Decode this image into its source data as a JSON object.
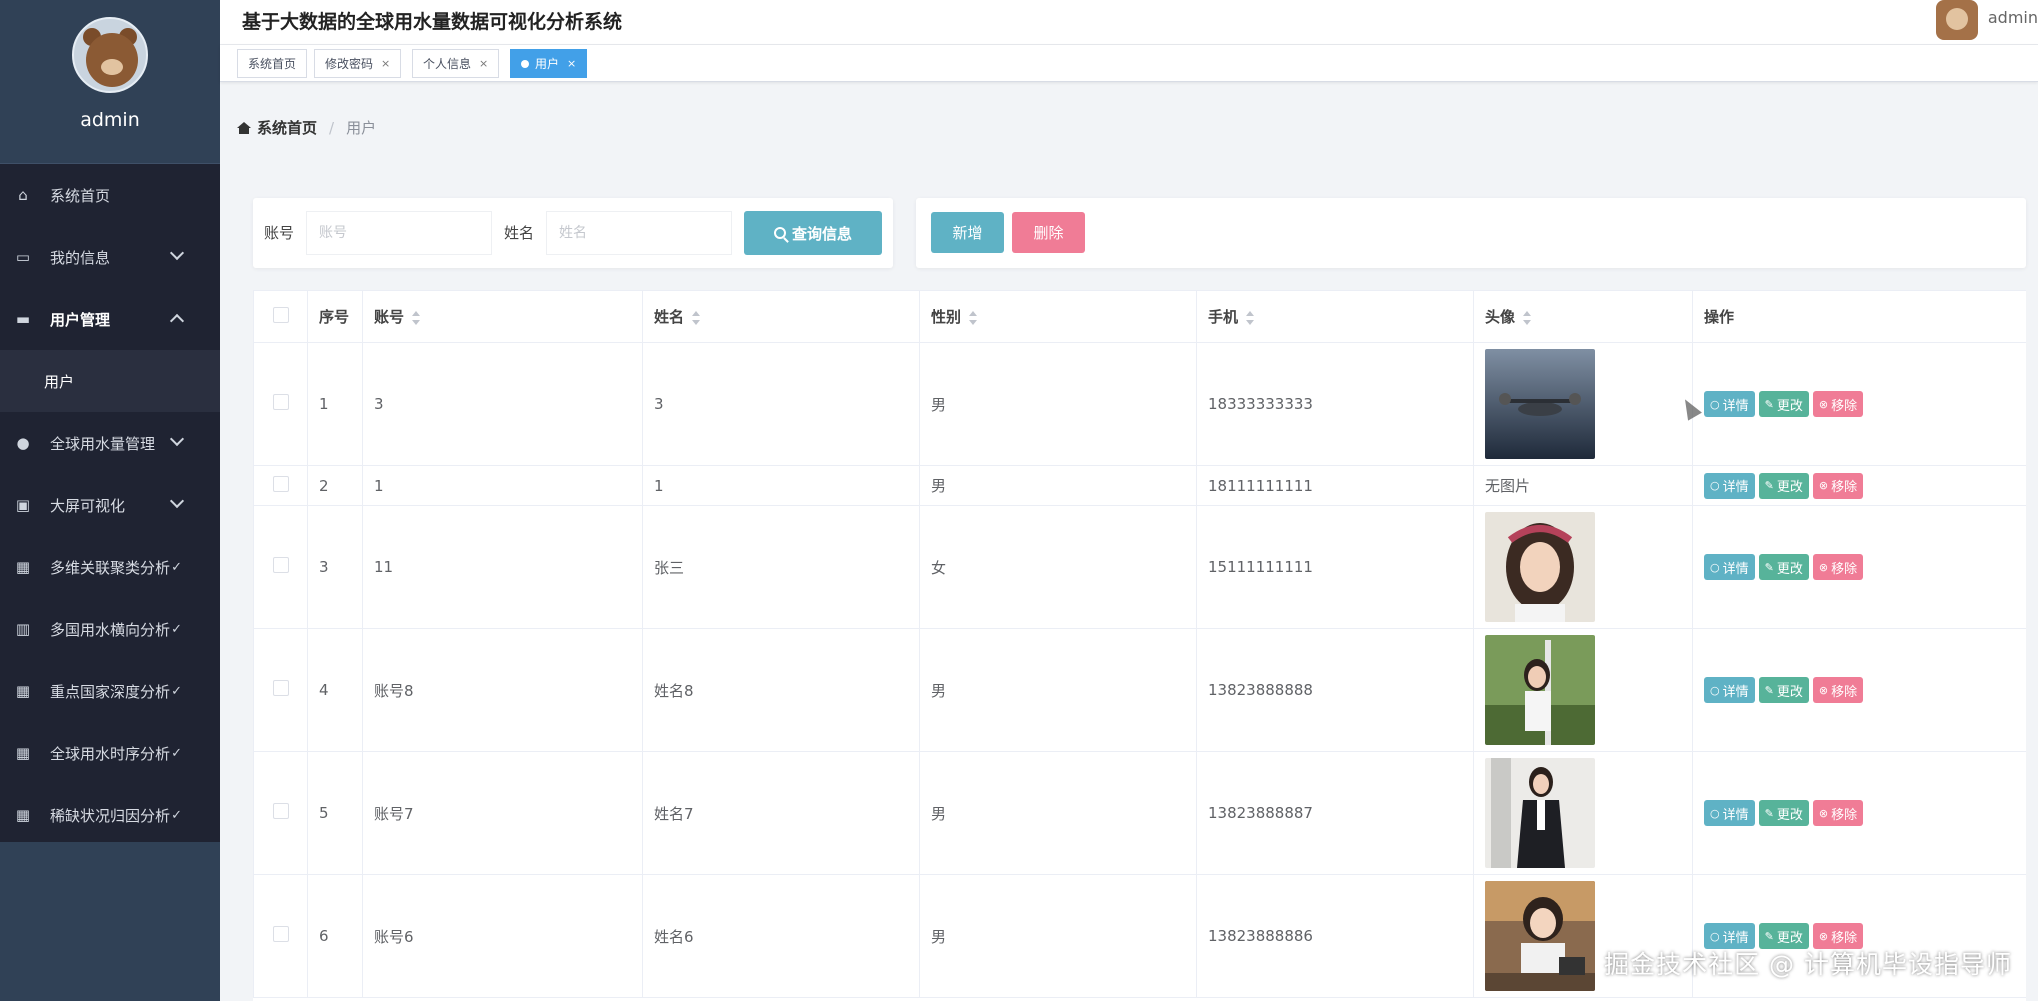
{
  "sidebar": {
    "username": "admin",
    "menu": {
      "home": "系统首页",
      "my_info": "我的信息",
      "user_mgmt": "用户管理",
      "user_sub": "用户",
      "water_mgmt": "全球用水量管理",
      "bigscreen": "大屏可视化",
      "cluster": "多维关联聚类分析",
      "horizontal": "多国用水横向分析",
      "depth": "重点国家深度分析",
      "timeseries": "全球用水时序分析",
      "scarcity": "稀缺状况归因分析"
    }
  },
  "header": {
    "title": "基于大数据的全球用水量数据可视化分析系统",
    "user": "admin"
  },
  "tabs": {
    "t1": "系统首页",
    "t2": "修改密码",
    "t3": "个人信息",
    "t4": "用户",
    "close": "×"
  },
  "breadcrumb": {
    "home": "系统首页",
    "sep": "/",
    "current": "用户"
  },
  "search": {
    "account_label": "账号",
    "account_placeholder": "账号",
    "name_label": "姓名",
    "name_placeholder": "姓名",
    "query_button": "查询信息"
  },
  "actions": {
    "add": "新增",
    "delete": "删除"
  },
  "table": {
    "headers": {
      "index": "序号",
      "account": "账号",
      "name": "姓名",
      "gender": "性别",
      "phone": "手机",
      "avatar": "头像",
      "ops": "操作"
    },
    "op_labels": {
      "detail": "详情",
      "edit": "更改",
      "remove": "移除"
    },
    "rows": [
      {
        "index": "1",
        "account": "3",
        "name": "3",
        "gender": "男",
        "phone": "18333333333",
        "avatar": "drone-photo"
      },
      {
        "index": "2",
        "account": "1",
        "name": "1",
        "gender": "男",
        "phone": "18111111111",
        "avatar_text": "无图片"
      },
      {
        "index": "3",
        "account": "11",
        "name": "张三",
        "gender": "女",
        "phone": "15111111111",
        "avatar": "girl-portrait-photo"
      },
      {
        "index": "4",
        "account": "账号8",
        "name": "姓名8",
        "gender": "男",
        "phone": "13823888888",
        "avatar": "girl-outdoor-photo"
      },
      {
        "index": "5",
        "account": "账号7",
        "name": "姓名7",
        "gender": "男",
        "phone": "13823888887",
        "avatar": "woman-suit-photo"
      },
      {
        "index": "6",
        "account": "账号6",
        "name": "姓名6",
        "gender": "男",
        "phone": "13823888886",
        "avatar": "girl-desk-photo"
      }
    ]
  },
  "watermark": "掘金技术社区 @ 计算机毕设指导师"
}
